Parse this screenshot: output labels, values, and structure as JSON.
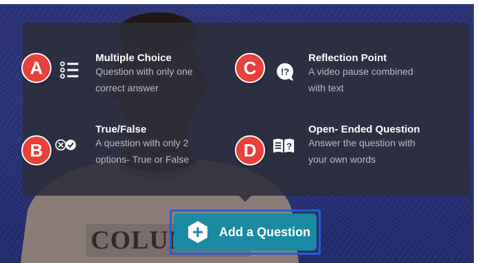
{
  "options": [
    {
      "letter": "A",
      "title": "Multiple Choice",
      "desc": "Question with only one correct answer",
      "icon": "list-icon"
    },
    {
      "letter": "B",
      "title": "True/False",
      "desc": "A question with only 2 options- True or False",
      "icon": "true-false-icon"
    },
    {
      "letter": "C",
      "title": "Reflection Point",
      "desc": "A video pause combined with text",
      "icon": "speech-question-icon"
    },
    {
      "letter": "D",
      "title": "Open- Ended Question",
      "desc": "Answer the question with your own words",
      "icon": "open-book-question-icon"
    }
  ],
  "add_button": {
    "label": "Add a Question",
    "icon": "plus-hexagon-icon"
  },
  "shirt_text": "COLUMBUS",
  "colors": {
    "badge": "#e8403a",
    "button": "#1a8aa2",
    "outline": "#1f60d8",
    "panel": "#2c2e3a",
    "background": "#2a3278"
  }
}
